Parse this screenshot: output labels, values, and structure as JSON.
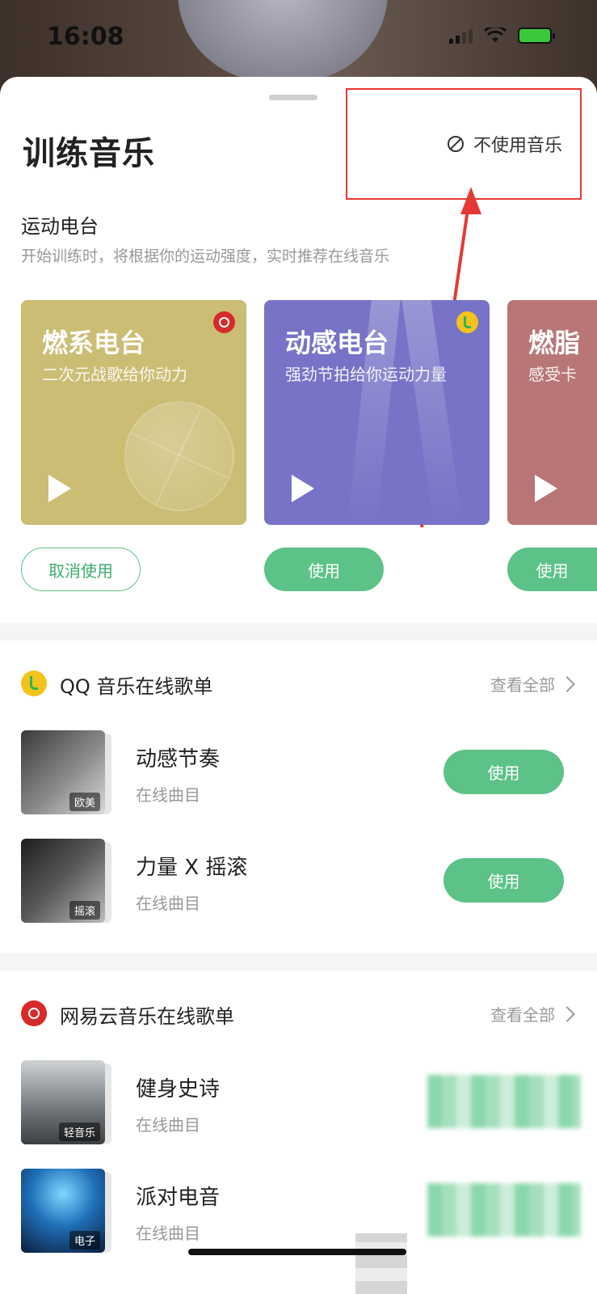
{
  "status_bar": {
    "time": "16:08"
  },
  "sheet": {
    "title": "训练音乐",
    "no_music_label": "不使用音乐"
  },
  "radio": {
    "title": "运动电台",
    "description": "开始训练时，将根据你的运动强度，实时推荐在线音乐",
    "cards": [
      {
        "title": "燃系电台",
        "subtitle": "二次元战歌给你动力",
        "button": "取消使用",
        "color": "#cbbd74",
        "brand": "netease-music-icon"
      },
      {
        "title": "动感电台",
        "subtitle": "强劲节拍给你运动力量",
        "button": "使用",
        "color": "#7773c7",
        "brand": "qq-music-icon"
      },
      {
        "title": "燃脂",
        "subtitle": "感受卡",
        "button": "使用",
        "color": "#b97676",
        "brand": ""
      }
    ]
  },
  "qq_section": {
    "title": "QQ 音乐在线歌单",
    "see_all": "查看全部",
    "items": [
      {
        "name": "动感节奏",
        "meta": "在线曲目",
        "tag": "欧美",
        "button": "使用"
      },
      {
        "name": "力量 X 摇滚",
        "meta": "在线曲目",
        "tag": "摇滚",
        "button": "使用"
      }
    ]
  },
  "netease_section": {
    "title": "网易云音乐在线歌单",
    "see_all": "查看全部",
    "items": [
      {
        "name": "健身史诗",
        "meta": "在线曲目",
        "tag": "轻音乐"
      },
      {
        "name": "派对电音",
        "meta": "在线曲目",
        "tag": "电子"
      }
    ]
  },
  "colors": {
    "accent_green": "#5cc288",
    "highlight_red": "#e53935"
  }
}
